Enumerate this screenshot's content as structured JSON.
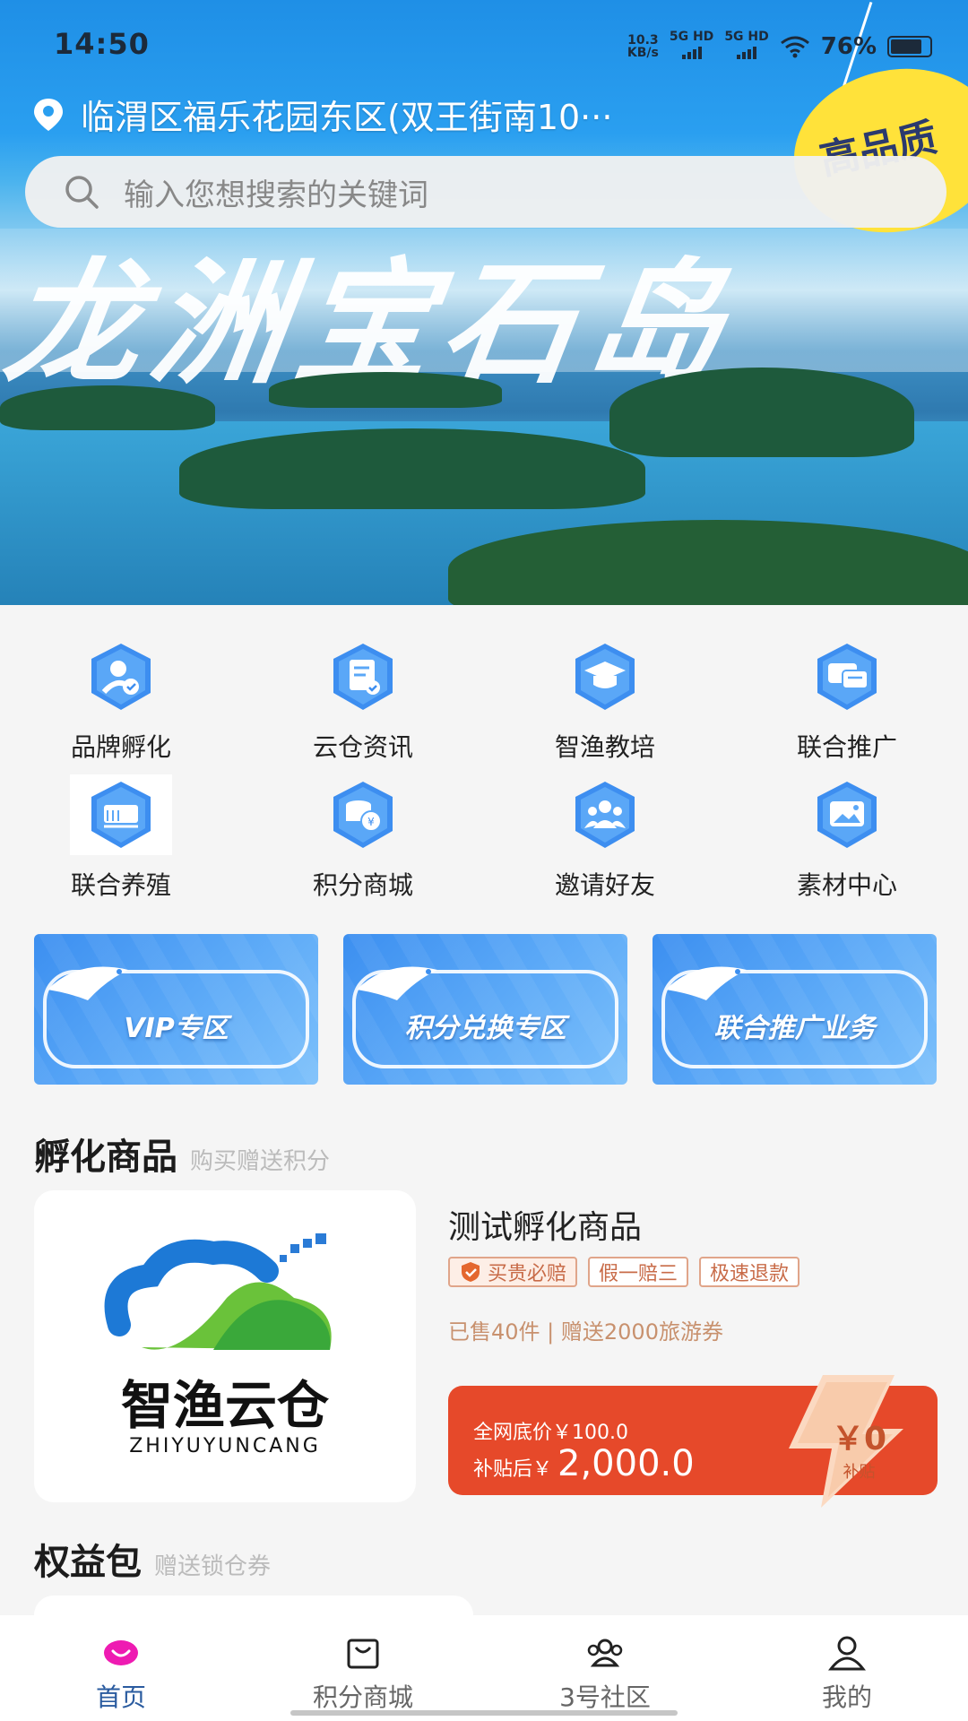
{
  "status_bar": {
    "time": "14:50",
    "net_speed_value": "10.3",
    "net_speed_unit": "KB/s",
    "sim1": "5G HD",
    "sim2": "5G HD",
    "battery": "76%"
  },
  "header": {
    "location": "临渭区福乐花园东区(双王街南10···",
    "search_placeholder": "输入您想搜索的关键词",
    "banner_text": "龙洲宝石岛",
    "tag_text": "高品质"
  },
  "icon_grid": [
    {
      "label": "品牌孵化",
      "icon": "brand-user-icon"
    },
    {
      "label": "云仓资讯",
      "icon": "news-document-icon"
    },
    {
      "label": "智渔教培",
      "icon": "graduation-cap-icon"
    },
    {
      "label": "联合推广",
      "icon": "chat-bubbles-icon"
    },
    {
      "label": "联合养殖",
      "icon": "aquaculture-icon"
    },
    {
      "label": "积分商城",
      "icon": "coin-stack-icon"
    },
    {
      "label": "邀请好友",
      "icon": "friends-group-icon"
    },
    {
      "label": "素材中心",
      "icon": "picture-folder-icon"
    }
  ],
  "zones": [
    {
      "label": "VIP专区"
    },
    {
      "label": "积分兑换专区"
    },
    {
      "label": "联合推广业务"
    }
  ],
  "incubation": {
    "title": "孵化商品",
    "subtitle": "购买赠送积分",
    "product": {
      "logo_text": "智渔云仓",
      "logo_subtext": "ZHIYUYUNCANG",
      "name": "测试孵化商品",
      "tags": [
        "买贵必赔",
        "假一赔三",
        "极速退款"
      ],
      "sold_info": "已售40件 | 赠送2000旅游券",
      "price_label": "全网底价￥100.0",
      "subsidy_prefix": "补贴后￥",
      "subsidy_price": "2,000.0",
      "subsidy_amount": "￥0",
      "subsidy_label": "补贴"
    }
  },
  "benefits": {
    "title": "权益包",
    "subtitle": "赠送锁仓券"
  },
  "bottom_nav": [
    {
      "label": "首页",
      "icon": "home-icon",
      "active": true
    },
    {
      "label": "积分商城",
      "icon": "shopping-bag-icon",
      "active": false
    },
    {
      "label": "3号社区",
      "icon": "community-icon",
      "active": false
    },
    {
      "label": "我的",
      "icon": "profile-icon",
      "active": false
    }
  ],
  "colors": {
    "accent_blue": "#2a5b9f",
    "price_red": "#e6492a",
    "tag_orange": "#c86b48"
  }
}
